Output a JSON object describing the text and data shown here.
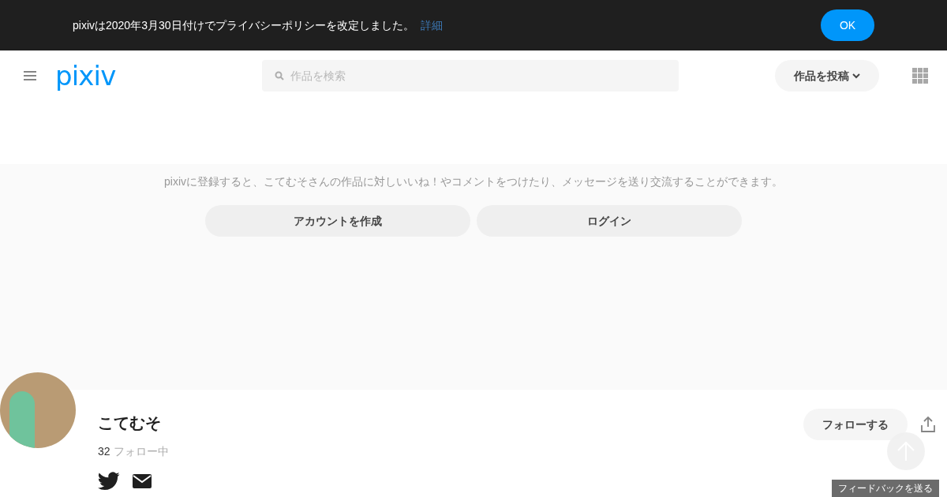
{
  "notice": {
    "text": "pixivは2020年3月30日付けでプライバシーポリシーを改定しました。",
    "link": "詳細",
    "button": "OK"
  },
  "header": {
    "logo": "pixiv",
    "search": {
      "placeholder": "作品を検索"
    },
    "post_button": "作品を投稿"
  },
  "signup": {
    "message": "pixivに登録すると、こてむそさんの作品に対しいいね！やコメントをつけたり、メッセージを送り交流することができます。",
    "buttons": [
      "アカウントを作成",
      "ログイン"
    ]
  },
  "profile": {
    "name": "こてむそ",
    "following_count": "32",
    "following_label": "フォロー中",
    "follow_button": "フォローする"
  },
  "feedback": "フィードバックを送る"
}
